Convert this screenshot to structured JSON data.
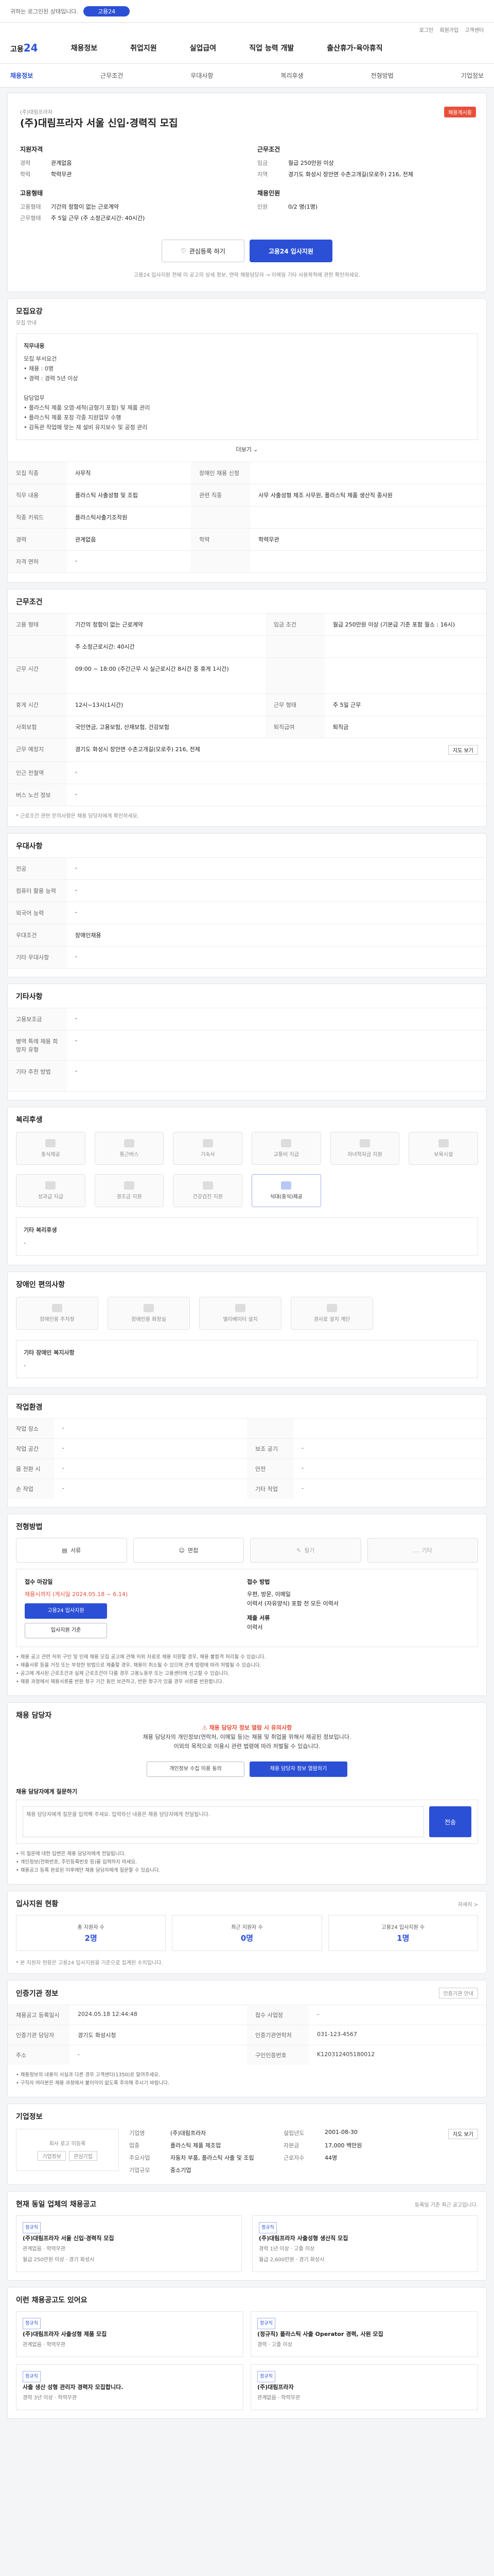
{
  "topbar": {
    "notice": "귀하는 로그인된 상태입니다.",
    "pill": "고용24"
  },
  "gnb": {
    "util": [
      "로그인",
      "회원가입",
      "고객센터"
    ],
    "logo_main": "고용",
    "logo_num": "24",
    "menu": [
      "채용정보",
      "취업지원",
      "실업급여",
      "직업 능력 개발",
      "출산휴가·육아휴직"
    ]
  },
  "subnav": [
    "채용정보",
    "근무조건",
    "우대사항",
    "복리후생",
    "전형방법",
    "기업정보"
  ],
  "title_card": {
    "company": "(주)대림프라자",
    "title": "(주)대림프라자 서울 신입·경력직 모집",
    "state": "채용게시중",
    "left_heading": "지원자격",
    "left": [
      {
        "k": "경력",
        "v": "관계없음"
      },
      {
        "k": "학력",
        "v": "학력무관"
      }
    ],
    "right_heading": "근무조건",
    "right": [
      {
        "k": "임금",
        "v": "월급 250만원 이상"
      },
      {
        "k": "지역",
        "v": "경기도 화성시 장안면 수촌고개길(모로주) 216, 전체"
      }
    ],
    "left2_heading": "고용형태",
    "left2": [
      {
        "k": "고용형태",
        "v": "기간의 정함이 없는 근로계약"
      },
      {
        "k": "근무형태",
        "v": "주 5일 근무 (주 소정근로시간: 40시간)"
      }
    ],
    "right2_heading": "채용인원",
    "right2": [
      {
        "k": "인원",
        "v": "0/2 명(1명)"
      }
    ],
    "btn_scrap": "관심등록 하기",
    "btn_apply": "고용24 입사지원",
    "note": "고용24 입사지원 전에 이 공고의 상세 정보, 연락 채용담당자 → 이메일 기타 사용목적에 관한 확인하세요."
  },
  "recruit": {
    "title": "모집요강",
    "note": "모집 안내",
    "box_heading": "직무내용",
    "box_lines": [
      "모집 부서요건",
      "• 채용 : 0명",
      "• 경력 : 경력 5년 이상",
      "",
      "담당업무",
      "• 플라스틱 제품 오염·세척(금형기 포함) 및 제품 관리",
      "• 플라스틱 제품 포장 각종 지원업무 수행",
      "• 감독관 작업에 맞는 재 설비 유지보수 및 공정 관리"
    ],
    "more": "더보기 ⌄",
    "rows": [
      {
        "k": "모집 직종",
        "v": "사무직",
        "k2": "장애인 채용 신청",
        "v2": ""
      },
      {
        "k": "직무 내용",
        "v": "플라스틱 사출성형 및 조립",
        "k2": "관련 직종",
        "v2": "사무 사출성형 제조 사무원, 플라스틱 제품 생산직 종사원"
      },
      {
        "k": "직종 키워드",
        "v": "플라스틱사출기조작원",
        "k2": "",
        "v2": ""
      },
      {
        "k": "경력",
        "v": "관계없음",
        "k2": "학력",
        "v2": "학력무관"
      },
      {
        "k": "자격 면허",
        "v": "-",
        "k2": "",
        "v2": ""
      }
    ]
  },
  "condition": {
    "title": "근무조건",
    "rows": [
      {
        "k": "고용 형태",
        "v": "기간의 정함이 없는 근로계약",
        "k2": "임금 조건",
        "v2": "월급 250만원 이상 (기본급 기준 포함 월소 : 16시)"
      },
      {
        "k": "",
        "v": "주 소정근로시간: 40시간",
        "k2": "",
        "v2": ""
      },
      {
        "k": "근무 시간",
        "v": "09:00 ~ 18:00 (주간근무 시 실근로시간 8시간 중 휴게 1시간)",
        "k2": "",
        "v2": ""
      },
      {
        "k": "휴게 시간",
        "v": "12시~13시(1시간)",
        "k2": "근무 형태",
        "v2": "주 5일 근무"
      },
      {
        "k": "사회보험",
        "v": "국민연금, 고용보험, 산재보험, 건강보험",
        "k2": "퇴직급여",
        "v2": "퇴직금"
      },
      {
        "k": "근무 예정지",
        "v": "경기도 화성시 장안면 수촌고개길(모로주) 216, 전체",
        "k2": "",
        "v2": ""
      },
      {
        "k": "인근 전철역",
        "v": "-",
        "k2": "",
        "v2": ""
      },
      {
        "k": "버스 노선 정보",
        "v": "-",
        "k2": "",
        "v2": ""
      }
    ],
    "map_btn": "지도 보기",
    "footnote": "* 근로조건 관련 문의사항은 채용 담당자에게 확인하세요."
  },
  "prefer": {
    "title": "우대사항",
    "rows": [
      {
        "k": "전공",
        "v": "-"
      },
      {
        "k": "컴퓨터 활용 능력",
        "v": "-"
      },
      {
        "k": "외국어 능력",
        "v": "-"
      },
      {
        "k": "우대조건",
        "v": "장애인채용"
      },
      {
        "k": "기타 우대사항",
        "v": "-"
      }
    ]
  },
  "etc": {
    "title": "기타사항",
    "rows": [
      {
        "k": "고용보조금",
        "v": "-"
      },
      {
        "k": "병역 특례 채용 희망자 유형",
        "v": "-"
      },
      {
        "k": "기타 추천 방법",
        "v": "-"
      }
    ]
  },
  "welfare": {
    "title": "복리후생",
    "icons": [
      "중식제공",
      "통근버스",
      "기숙사",
      "교통비 지급",
      "자녀학자금 지원",
      "보육시설",
      "성과급 지급",
      "경조금 지원",
      "건강검진 지원",
      "식대(중식)제공"
    ],
    "active_index": 9,
    "etc_title": "기타 복리후생",
    "etc_value": "-"
  },
  "disability": {
    "title": "장애인 편의사항",
    "icons": [
      "장애인용 주차장",
      "장애인용 화장실",
      "엘리베이터 설치",
      "경사로 설치 계단"
    ],
    "etc_title": "기타 장애인 복지사항",
    "etc_value": "-"
  },
  "staffing": {
    "title": "작업환경",
    "rows": [
      [
        "작업 장소",
        "-",
        "",
        ""
      ],
      [
        "작업 공간",
        "-",
        "보조 공기",
        "-"
      ],
      [
        "몸 전환 시",
        "-",
        "안전",
        "-"
      ],
      [
        "손 작업",
        "-",
        "기타 작업",
        "-"
      ]
    ]
  },
  "method": {
    "title": "전형방법",
    "tabs": [
      "서류",
      "면접",
      "필기",
      "기타"
    ],
    "left_heading": "접수 마감일",
    "deadline": "채용시까지 (게시일 2024.05.18 ~ 6.14)",
    "btn_apply": "고용24 입사지원",
    "btn_mail": "입사지원 기준",
    "right_heading": "접수 방법",
    "right_lines": [
      "우편, 방문, 이메일",
      "이력서 (자유양식) 포함 전 모든 이력서",
      "",
      "제출 서류",
      "이력서"
    ],
    "bullets": [
      "• 채용 공고 관련 허위 구인 및 인재 채용 모집 공고에 관해 허위 자료로 채용 지원할 경우, 채용 불합격 처리될 수 있습니다.",
      "• 제출서류 등을 거짓 또는 부정한 방법으로 제출할 경우, 채용이 취소될 수 있으며 관계 법령에 따라 처벌될 수 있습니다.",
      "• 공고에 게시된 근로조건과 실제 근로조건이 다를 경우 고용노동부 또는 고용센터에 신고할 수 있습니다.",
      "• 채용 과정에서 채용서류를 반환 청구 기간 동안 보관하고, 반환 청구가 있을 경우 서류를 반환합니다."
    ]
  },
  "contact": {
    "title": "채용 담당자",
    "warn": "채용 담당자 정보 열람 시 유의사항",
    "lines": [
      "채용 담당자의 개인정보(연락처, 이메일 등)는 채용 및 취업을 위해서 제공된 정보입니다.",
      "이외의 목적으로 이용시 관련 법령에 따라 처벌될 수 있습니다."
    ],
    "btn_agree": "개인정보 수집 이용 동의",
    "btn_view": "채용 담당자 정보 열람하기",
    "ask_title": "채용 담당자에게 질문하기",
    "ask_placeholder": "채용 담당자에게 질문을 입력해 주세요. 입력하신 내용은 채용 담당자에게 전달됩니다.",
    "ask_btn": "전송",
    "ask_notes": [
      "• 이 질문에 대한 답변은 채용 담당자에게 전달됩니다.",
      "• 개인정보(전화번호, 주민등록번호 등)를 입력하지 마세요.",
      "• 채용공고 등록 완료된 이후에만 채용 담당자에게 질문할 수 있습니다."
    ]
  },
  "applicants": {
    "title": "입사지원 현황",
    "link": "자세히 >",
    "stats": [
      {
        "k": "총 지원자 수",
        "v": "2명"
      },
      {
        "k": "최근 지원자 수",
        "v": "0명"
      },
      {
        "k": "고용24 입사지원 수",
        "v": "1명"
      }
    ],
    "note": "* 본 지원자 현황은 고용24 입사지원을 기준으로 집계된 수치입니다."
  },
  "process": {
    "title": "인증기관 정보",
    "link": "인증기관 안내",
    "rows": [
      [
        "채용공고 등록일시",
        "2024.05.18 12:44:48",
        "접수 사업장",
        "-"
      ],
      [
        "인증기관 담당자",
        "경기도 화성시청",
        "인증기관연락처",
        "031-123-4567"
      ],
      [
        "주소",
        "-",
        "구인인증번호",
        "K120312405180012"
      ]
    ],
    "notes": [
      "• 채용정보의 내용이 사실과 다른 경우 고객센터(1350)로 알려주세요.",
      "• 구직자 여러분은 채용 과정에서 불이익이 없도록 주의해 주시기 바랍니다."
    ]
  },
  "company": {
    "title": "기업정보",
    "logo_note": "회사 로고 미등록",
    "btn_info": "기업정보",
    "btn_follow": "관심기업",
    "fields": [
      [
        "기업명",
        "(주)대림프라자",
        "설립년도",
        "2001-08-30"
      ],
      [
        "업종",
        "플라스틱 제품 제조업",
        "자본금",
        "17,000 백만원"
      ],
      [
        "주요사업",
        "자동차 부품, 플라스틱 사출 및 조립",
        "근로자수",
        "44명"
      ],
      [
        "기업규모",
        "중소기업",
        "",
        ""
      ]
    ],
    "map_btn": "지도 보기"
  },
  "same_company": {
    "title": "현재 동일 업체의 채용공고",
    "note": "등록일 기준 최근 공고입니다.",
    "jobs": [
      {
        "tag": "정규직",
        "title": "(주)대림프라자 서울 신입·경력직 모집",
        "meta": "관계없음 · 학력무관",
        "info": "월급 250만원 이상 · 경기 화성시"
      },
      {
        "tag": "정규직",
        "title": "(주)대림프라자 사출성형 생산직 모집",
        "meta": "경력 1년 이상 · 고졸 이상",
        "info": "월급 2,600만원 · 경기 화성시"
      }
    ]
  },
  "recommend": {
    "title": "이런 채용공고도 있어요",
    "jobs": [
      {
        "tag": "정규직",
        "title": "(주)대림프라자 사출성형 제품 모집",
        "meta": "관계없음 · 학력무관"
      },
      {
        "tag": "정규직",
        "title": "(정규직) 플라스틱 사출 Operator 경력, 사원 모집",
        "meta": "경력 · 고졸 이상"
      },
      {
        "tag": "정규직",
        "title": "사출 생산 성형 관리자 경력자 모집합니다.",
        "meta": "경력 3년 이상 · 학력무관"
      },
      {
        "tag": "정규직",
        "title": "(주)대림프라자",
        "meta": "관계없음 · 학력무관"
      }
    ]
  }
}
